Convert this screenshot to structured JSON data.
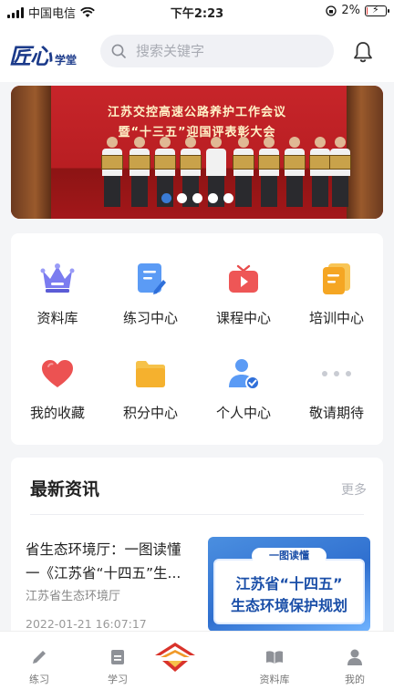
{
  "status_bar": {
    "carrier": "中国电信",
    "time": "下午2:23",
    "battery": "2%",
    "battery_level": 0.02
  },
  "header": {
    "logo_main": "匠心",
    "logo_sub": "学堂",
    "search_placeholder": "搜索关键字",
    "icons": {
      "search": "search-icon",
      "notification": "bell-icon"
    }
  },
  "banner": {
    "line1": "江苏交控高速公路养护工作会议",
    "line2": "暨“十三五”迎国评表彰大会",
    "slide_count": 5,
    "active_slide": 0
  },
  "menu": [
    {
      "label": "资料库",
      "icon": "crown-icon",
      "color": "#6d6ee6"
    },
    {
      "label": "练习中心",
      "icon": "document-edit-icon",
      "color": "#4a8df0"
    },
    {
      "label": "课程中心",
      "icon": "video-play-icon",
      "color": "#e84b4b"
    },
    {
      "label": "培训中心",
      "icon": "notes-icon",
      "color": "#f5a623"
    },
    {
      "label": "我的收藏",
      "icon": "heart-icon",
      "color": "#e84b4b"
    },
    {
      "label": "积分中心",
      "icon": "folder-icon",
      "color": "#f5b731"
    },
    {
      "label": "个人中心",
      "icon": "user-check-icon",
      "color": "#4a8df0"
    },
    {
      "label": "敬请期待",
      "icon": "more-dots-icon",
      "color": "#c9ccd3"
    }
  ],
  "news": {
    "title": "最新资讯",
    "more": "更多",
    "article": {
      "title_line1": "省生态环境厅：一图读懂",
      "title_line2": "一《江苏省“十四五”生...",
      "source": "江苏省生态环境厅",
      "time": "2022-01-21 16:07:17",
      "image_tag": "一图读懂",
      "image_line1": "江苏省“十四五”",
      "image_line2": "生态环境保护规划"
    }
  },
  "tabbar": {
    "items": [
      {
        "label": "练习",
        "icon": "pencil-icon"
      },
      {
        "label": "学习",
        "icon": "book-icon"
      },
      {
        "label": "",
        "icon": "home-logo-icon"
      },
      {
        "label": "资料库",
        "icon": "library-icon"
      },
      {
        "label": "我的",
        "icon": "person-icon"
      }
    ]
  }
}
